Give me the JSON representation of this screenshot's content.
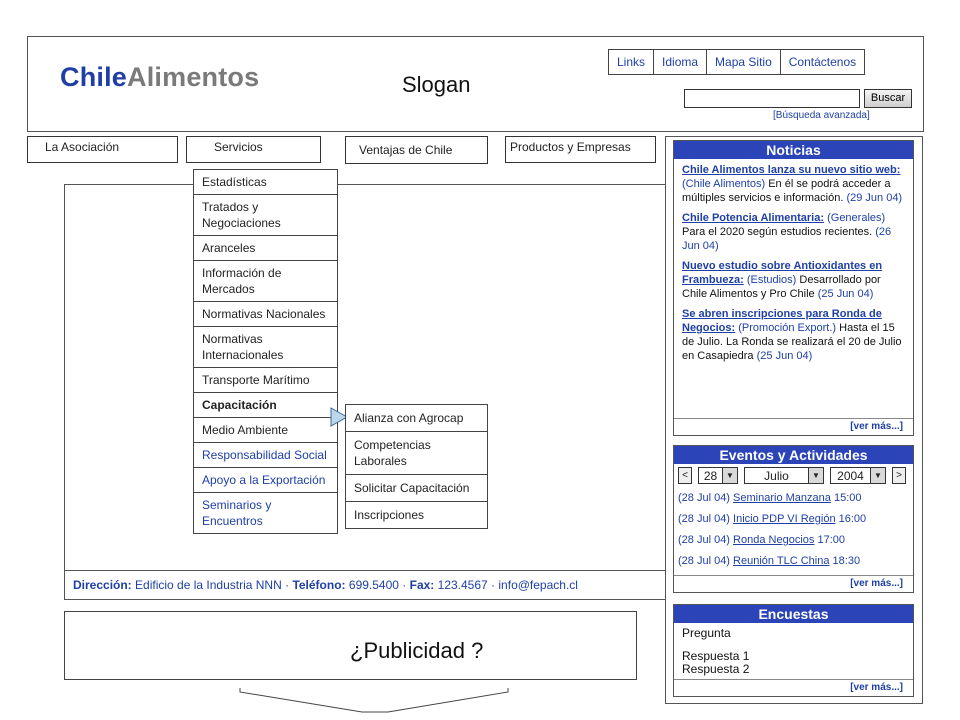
{
  "header": {
    "logo_part1": "Chile",
    "logo_part2": "Alimentos",
    "slogan": "Slogan",
    "toplinks": [
      "Links",
      "Idioma",
      "Mapa Sitio",
      "Contáctenos"
    ],
    "search_button": "Buscar",
    "advanced_search": "[Búsqueda avanzada]"
  },
  "nav": {
    "items": [
      "La Asociación",
      "Servicios",
      "Ventajas de Chile",
      "Productos y Empresas"
    ]
  },
  "dropdown": {
    "items": [
      "Estadísticas",
      "Tratados y Negociaciones",
      "Aranceles",
      "Información de Mercados",
      "Normativas Nacionales",
      "Normativas Internacionales",
      "Transporte Marítimo",
      "Capacitación",
      "Medio Ambiente",
      "Responsabilidad Social",
      "Apoyo a la Exportación",
      "Seminarios y Encuentros"
    ]
  },
  "submenu": {
    "items": [
      "Alianza con Agrocap",
      "Competencias Laborales",
      "Solicitar Capacitación",
      "Inscripciones"
    ]
  },
  "footer": {
    "direccion_label": "Dirección:",
    "direccion": "Edificio de la Industria NNN",
    "telefono_label": "Teléfono:",
    "telefono": "699.5400",
    "fax_label": "Fax:",
    "fax": "123.4567",
    "email": "info@fepach.cl"
  },
  "ad": {
    "text": "¿Publicidad ?"
  },
  "noticias": {
    "title": "Noticias",
    "more": "[ver más...]",
    "items": [
      {
        "link": "Chile Alimentos lanza su nuevo sitio web:",
        "category": "(Chile Alimentos)",
        "text": "En él se podrá acceder a múltiples servicios e información.",
        "date": "(29 Jun 04)"
      },
      {
        "link": "Chile Potencia Alimentaria:",
        "category": "(Generales)",
        "text": "Para el 2020 según estudios recientes.",
        "date": "(26 Jun 04)"
      },
      {
        "link": "Nuevo estudio sobre Antioxidantes en Frambueza:",
        "category": "(Estudios)",
        "text": "Desarrollado por Chile Alimentos y Pro Chile",
        "date": "(25 Jun 04)"
      },
      {
        "link": "Se abren inscripciones para Ronda de Negocios:",
        "category": "(Promoción Export.)",
        "text": "Hasta el 15 de Julio. La Ronda se realizará el 20 de Julio en Casapiedra",
        "date": "(25 Jun 04)"
      }
    ]
  },
  "eventos": {
    "title": "Eventos y Actividades",
    "prev": "<",
    "next": ">",
    "day": "28",
    "month": "Julio",
    "year": "2004",
    "more": "[ver más...]",
    "items": [
      {
        "date": "(28 Jul 04)",
        "name": "Seminario Manzana",
        "time": "15:00"
      },
      {
        "date": "(28 Jul 04)",
        "name": "Inicio PDP VI Región",
        "time": "16:00"
      },
      {
        "date": "(28 Jul 04)",
        "name": "Ronda Negocios",
        "time": "17:00"
      },
      {
        "date": "(28 Jul 04)",
        "name": "Reunión TLC China",
        "time": "18:30"
      }
    ]
  },
  "encuestas": {
    "title": "Encuestas",
    "question": "Pregunta",
    "answers": [
      "Respuesta 1",
      "Respuesta 2"
    ],
    "more": "[ver más...]"
  }
}
